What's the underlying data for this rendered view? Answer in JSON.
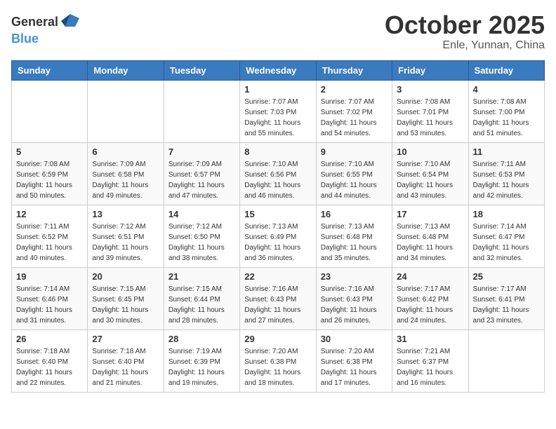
{
  "header": {
    "logo_general": "General",
    "logo_blue": "Blue",
    "title": "October 2025",
    "subtitle": "Enle, Yunnan, China"
  },
  "calendar": {
    "days_of_week": [
      "Sunday",
      "Monday",
      "Tuesday",
      "Wednesday",
      "Thursday",
      "Friday",
      "Saturday"
    ],
    "weeks": [
      [
        {
          "day": "",
          "info": ""
        },
        {
          "day": "",
          "info": ""
        },
        {
          "day": "",
          "info": ""
        },
        {
          "day": "1",
          "info": "Sunrise: 7:07 AM\nSunset: 7:03 PM\nDaylight: 11 hours\nand 55 minutes."
        },
        {
          "day": "2",
          "info": "Sunrise: 7:07 AM\nSunset: 7:02 PM\nDaylight: 11 hours\nand 54 minutes."
        },
        {
          "day": "3",
          "info": "Sunrise: 7:08 AM\nSunset: 7:01 PM\nDaylight: 11 hours\nand 53 minutes."
        },
        {
          "day": "4",
          "info": "Sunrise: 7:08 AM\nSunset: 7:00 PM\nDaylight: 11 hours\nand 51 minutes."
        }
      ],
      [
        {
          "day": "5",
          "info": "Sunrise: 7:08 AM\nSunset: 6:59 PM\nDaylight: 11 hours\nand 50 minutes."
        },
        {
          "day": "6",
          "info": "Sunrise: 7:09 AM\nSunset: 6:58 PM\nDaylight: 11 hours\nand 49 minutes."
        },
        {
          "day": "7",
          "info": "Sunrise: 7:09 AM\nSunset: 6:57 PM\nDaylight: 11 hours\nand 47 minutes."
        },
        {
          "day": "8",
          "info": "Sunrise: 7:10 AM\nSunset: 6:56 PM\nDaylight: 11 hours\nand 46 minutes."
        },
        {
          "day": "9",
          "info": "Sunrise: 7:10 AM\nSunset: 6:55 PM\nDaylight: 11 hours\nand 44 minutes."
        },
        {
          "day": "10",
          "info": "Sunrise: 7:10 AM\nSunset: 6:54 PM\nDaylight: 11 hours\nand 43 minutes."
        },
        {
          "day": "11",
          "info": "Sunrise: 7:11 AM\nSunset: 6:53 PM\nDaylight: 11 hours\nand 42 minutes."
        }
      ],
      [
        {
          "day": "12",
          "info": "Sunrise: 7:11 AM\nSunset: 6:52 PM\nDaylight: 11 hours\nand 40 minutes."
        },
        {
          "day": "13",
          "info": "Sunrise: 7:12 AM\nSunset: 6:51 PM\nDaylight: 11 hours\nand 39 minutes."
        },
        {
          "day": "14",
          "info": "Sunrise: 7:12 AM\nSunset: 6:50 PM\nDaylight: 11 hours\nand 38 minutes."
        },
        {
          "day": "15",
          "info": "Sunrise: 7:13 AM\nSunset: 6:49 PM\nDaylight: 11 hours\nand 36 minutes."
        },
        {
          "day": "16",
          "info": "Sunrise: 7:13 AM\nSunset: 6:48 PM\nDaylight: 11 hours\nand 35 minutes."
        },
        {
          "day": "17",
          "info": "Sunrise: 7:13 AM\nSunset: 6:48 PM\nDaylight: 11 hours\nand 34 minutes."
        },
        {
          "day": "18",
          "info": "Sunrise: 7:14 AM\nSunset: 6:47 PM\nDaylight: 11 hours\nand 32 minutes."
        }
      ],
      [
        {
          "day": "19",
          "info": "Sunrise: 7:14 AM\nSunset: 6:46 PM\nDaylight: 11 hours\nand 31 minutes."
        },
        {
          "day": "20",
          "info": "Sunrise: 7:15 AM\nSunset: 6:45 PM\nDaylight: 11 hours\nand 30 minutes."
        },
        {
          "day": "21",
          "info": "Sunrise: 7:15 AM\nSunset: 6:44 PM\nDaylight: 11 hours\nand 28 minutes."
        },
        {
          "day": "22",
          "info": "Sunrise: 7:16 AM\nSunset: 6:43 PM\nDaylight: 11 hours\nand 27 minutes."
        },
        {
          "day": "23",
          "info": "Sunrise: 7:16 AM\nSunset: 6:43 PM\nDaylight: 11 hours\nand 26 minutes."
        },
        {
          "day": "24",
          "info": "Sunrise: 7:17 AM\nSunset: 6:42 PM\nDaylight: 11 hours\nand 24 minutes."
        },
        {
          "day": "25",
          "info": "Sunrise: 7:17 AM\nSunset: 6:41 PM\nDaylight: 11 hours\nand 23 minutes."
        }
      ],
      [
        {
          "day": "26",
          "info": "Sunrise: 7:18 AM\nSunset: 6:40 PM\nDaylight: 11 hours\nand 22 minutes."
        },
        {
          "day": "27",
          "info": "Sunrise: 7:18 AM\nSunset: 6:40 PM\nDaylight: 11 hours\nand 21 minutes."
        },
        {
          "day": "28",
          "info": "Sunrise: 7:19 AM\nSunset: 6:39 PM\nDaylight: 11 hours\nand 19 minutes."
        },
        {
          "day": "29",
          "info": "Sunrise: 7:20 AM\nSunset: 6:38 PM\nDaylight: 11 hours\nand 18 minutes."
        },
        {
          "day": "30",
          "info": "Sunrise: 7:20 AM\nSunset: 6:38 PM\nDaylight: 11 hours\nand 17 minutes."
        },
        {
          "day": "31",
          "info": "Sunrise: 7:21 AM\nSunset: 6:37 PM\nDaylight: 11 hours\nand 16 minutes."
        },
        {
          "day": "",
          "info": ""
        }
      ]
    ]
  }
}
